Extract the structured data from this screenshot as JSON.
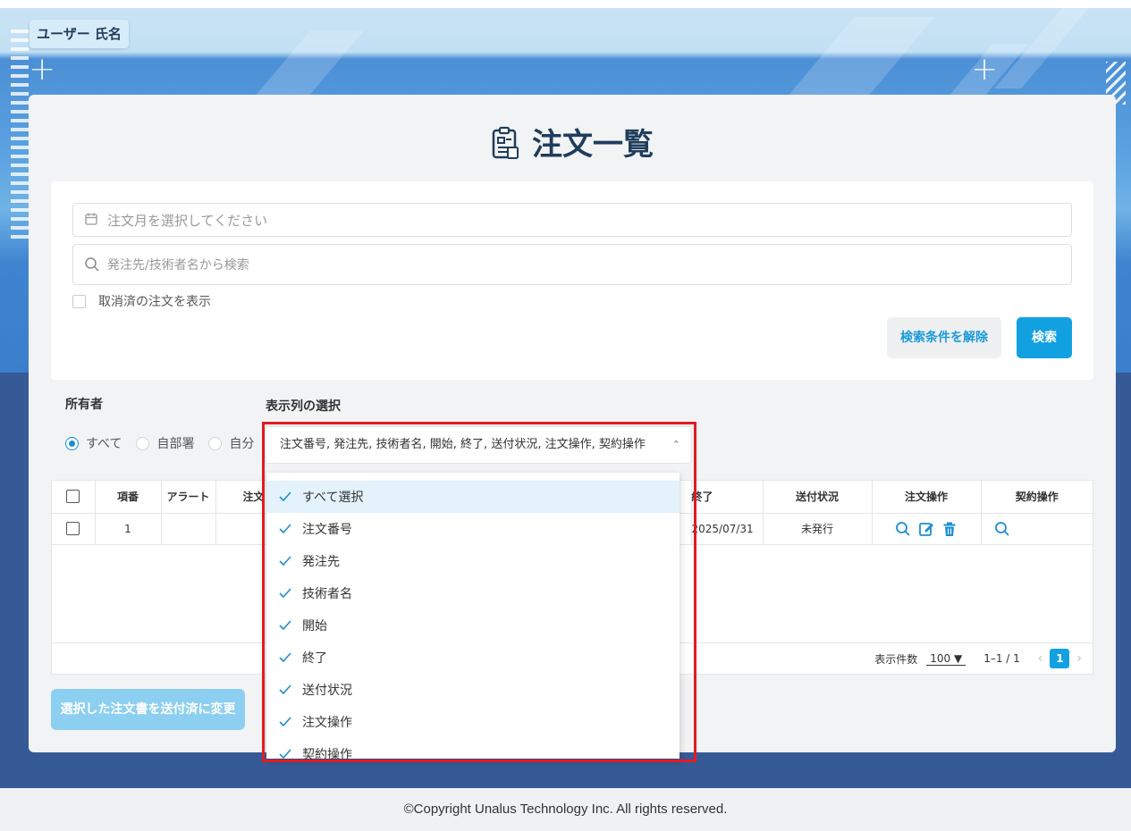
{
  "user": {
    "name": "ユーザー 氏名"
  },
  "page": {
    "title": "注文一覧"
  },
  "search": {
    "month_placeholder": "注文月を選択してください",
    "keyword_placeholder": "発注先/技術者名から検索",
    "show_cancelled_label": "取消済の注文を表示",
    "clear_label": "検索条件を解除",
    "search_label": "検索"
  },
  "owner": {
    "label": "所有者",
    "options": [
      "すべて",
      "自部署",
      "自分"
    ],
    "selected": "すべて"
  },
  "columns": {
    "label": "表示列の選択",
    "selected_text": "注文番号, 発注先, 技術者名, 開始, 終了, 送付状況, 注文操作, 契約操作",
    "options": [
      "すべて選択",
      "注文番号",
      "発注先",
      "技術者名",
      "開始",
      "終了",
      "送付状況",
      "注文操作",
      "契約操作"
    ]
  },
  "table": {
    "headers": [
      "項番",
      "アラート",
      "注文",
      "終了",
      "送付状況",
      "注文操作",
      "契約操作"
    ],
    "rows": [
      {
        "index": "1",
        "alert": "",
        "end": "2025/07/31",
        "status": "未発行"
      }
    ]
  },
  "pager": {
    "per_page_label": "表示件数",
    "per_page": "100",
    "range": "1–1 / 1",
    "page": "1"
  },
  "bulk_button": "選択した注文書を送付済に変更",
  "footer": "©Copyright Unalus Technology Inc. All rights reserved.",
  "colors": {
    "accent": "#12a1e0",
    "highlight": "#e31b23"
  }
}
